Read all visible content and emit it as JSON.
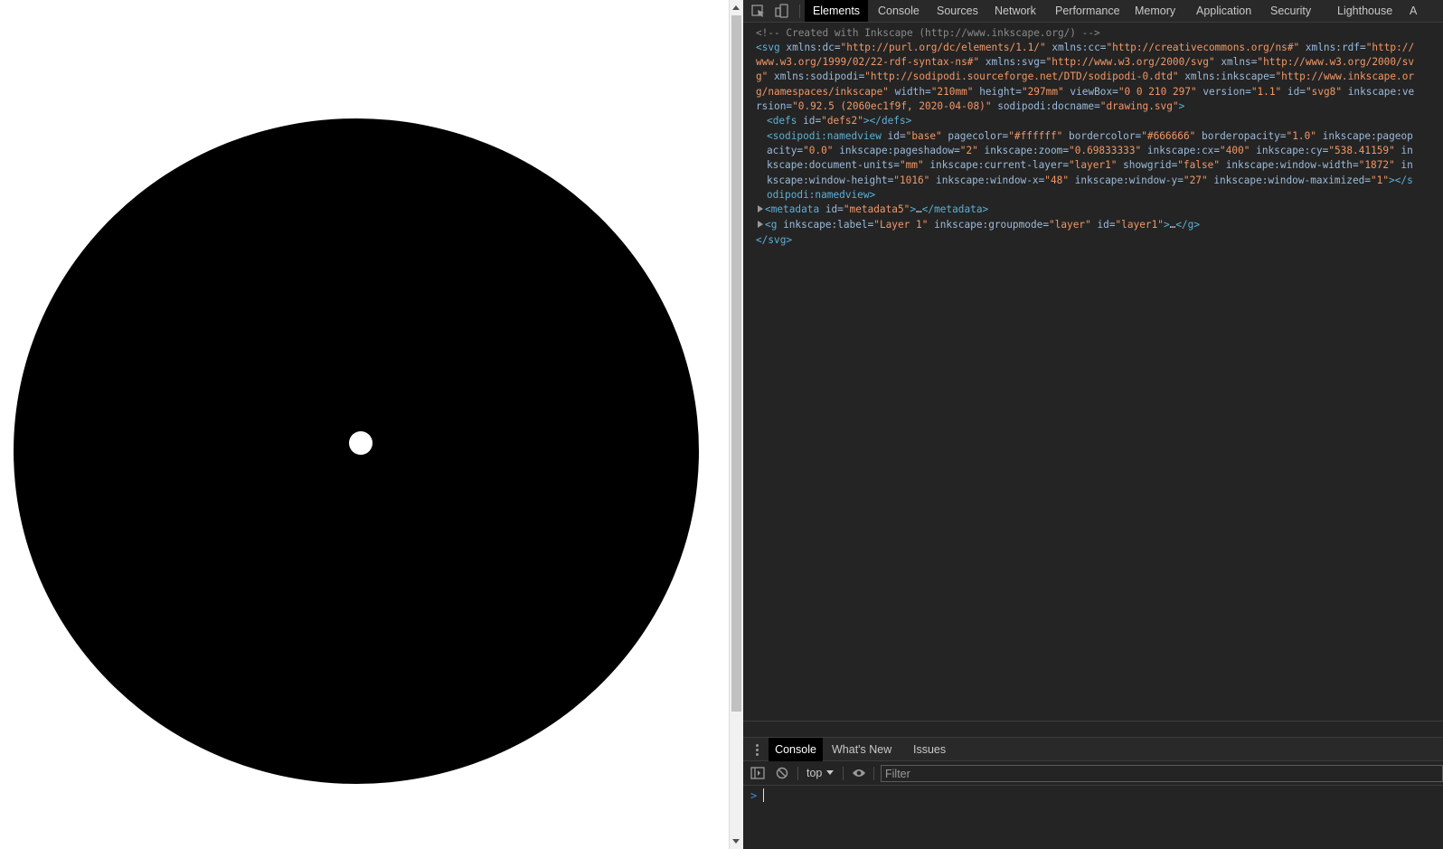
{
  "page": {
    "background": "#ffffff",
    "drawing": {
      "outer_fill": "#000000",
      "inner_fill": "#ffffff"
    }
  },
  "devtools": {
    "tabs": [
      "Elements",
      "Console",
      "Sources",
      "Network",
      "Performance",
      "Memory",
      "Application",
      "Security",
      "Lighthouse",
      "A"
    ],
    "active_tab": "Elements",
    "dom": {
      "comment": "<!-- Created with Inkscape (http://www.inkscape.org/) -->",
      "svg_open_tag": "svg",
      "svg_attrs": [
        {
          "name": "xmlns:dc",
          "value": "\"http://purl.org/dc/elements/1.1/\""
        },
        {
          "name": "xmlns:cc",
          "value": "\"http://creativecommons.org/ns#\""
        },
        {
          "name": "xmlns:rdf",
          "value": "\"http://www.w3.org/1999/02/22-rdf-syntax-ns#\""
        },
        {
          "name": "xmlns:svg",
          "value": "\"http://www.w3.org/2000/svg\""
        },
        {
          "name": "xmlns",
          "value": "\"http://www.w3.org/2000/svg\""
        },
        {
          "name": "xmlns:sodipodi",
          "value": "\"http://sodipodi.sourceforge.net/DTD/sodipodi-0.dtd\""
        },
        {
          "name": "xmlns:inkscape",
          "value": "\"http://www.inkscape.org/namespaces/inkscape\""
        },
        {
          "name": "width",
          "value": "\"210mm\""
        },
        {
          "name": "height",
          "value": "\"297mm\""
        },
        {
          "name": "viewBox",
          "value": "\"0 0 210 297\""
        },
        {
          "name": "version",
          "value": "\"1.1\""
        },
        {
          "name": "id",
          "value": "\"svg8\""
        },
        {
          "name": "inkscape:version",
          "value": "\"0.92.5 (2060ec1f9f, 2020-04-08)\""
        },
        {
          "name": "sodipodi:docname",
          "value": "\"drawing.svg\""
        }
      ],
      "defs_tag": "defs",
      "defs_attr": {
        "name": "id",
        "value": "\"defs2\""
      },
      "defs_close": "</defs>",
      "namedview_tag": "sodipodi:namedview",
      "namedview_attrs": [
        {
          "name": "id",
          "value": "\"base\""
        },
        {
          "name": "pagecolor",
          "value": "\"#ffffff\""
        },
        {
          "name": "bordercolor",
          "value": "\"#666666\""
        },
        {
          "name": "borderopacity",
          "value": "\"1.0\""
        },
        {
          "name": "inkscape:pageopacity",
          "value": "\"0.0\""
        },
        {
          "name": "inkscape:pageshadow",
          "value": "\"2\""
        },
        {
          "name": "inkscape:zoom",
          "value": "\"0.69833333\""
        },
        {
          "name": "inkscape:cx",
          "value": "\"400\""
        },
        {
          "name": "inkscape:cy",
          "value": "\"538.41159\""
        },
        {
          "name": "inkscape:document-units",
          "value": "\"mm\""
        },
        {
          "name": "inkscape:current-layer",
          "value": "\"layer1\""
        },
        {
          "name": "showgrid",
          "value": "\"false\""
        },
        {
          "name": "inkscape:window-width",
          "value": "\"1872\""
        },
        {
          "name": "inkscape:window-height",
          "value": "\"1016\""
        },
        {
          "name": "inkscape:window-x",
          "value": "\"48\""
        },
        {
          "name": "inkscape:window-y",
          "value": "\"27\""
        },
        {
          "name": "inkscape:window-maximized",
          "value": "\"1\""
        }
      ],
      "namedview_close": "</sodipodi:namedview>",
      "metadata_tag": "metadata",
      "metadata_attr": {
        "name": "id",
        "value": "\"metadata5\""
      },
      "metadata_close": "</metadata>",
      "g_tag": "g",
      "g_attrs": [
        {
          "name": "inkscape:label",
          "value": "\"Layer 1\""
        },
        {
          "name": "inkscape:groupmode",
          "value": "\"layer\""
        },
        {
          "name": "id",
          "value": "\"layer1\""
        }
      ],
      "g_close": "</g>",
      "ellipsis": "…",
      "svg_close": "</svg>"
    },
    "drawer": {
      "tabs": [
        "Console",
        "What's New",
        "Issues"
      ],
      "active_tab": "Console",
      "context": "top",
      "filter_placeholder": "Filter",
      "prompt": ">"
    }
  }
}
